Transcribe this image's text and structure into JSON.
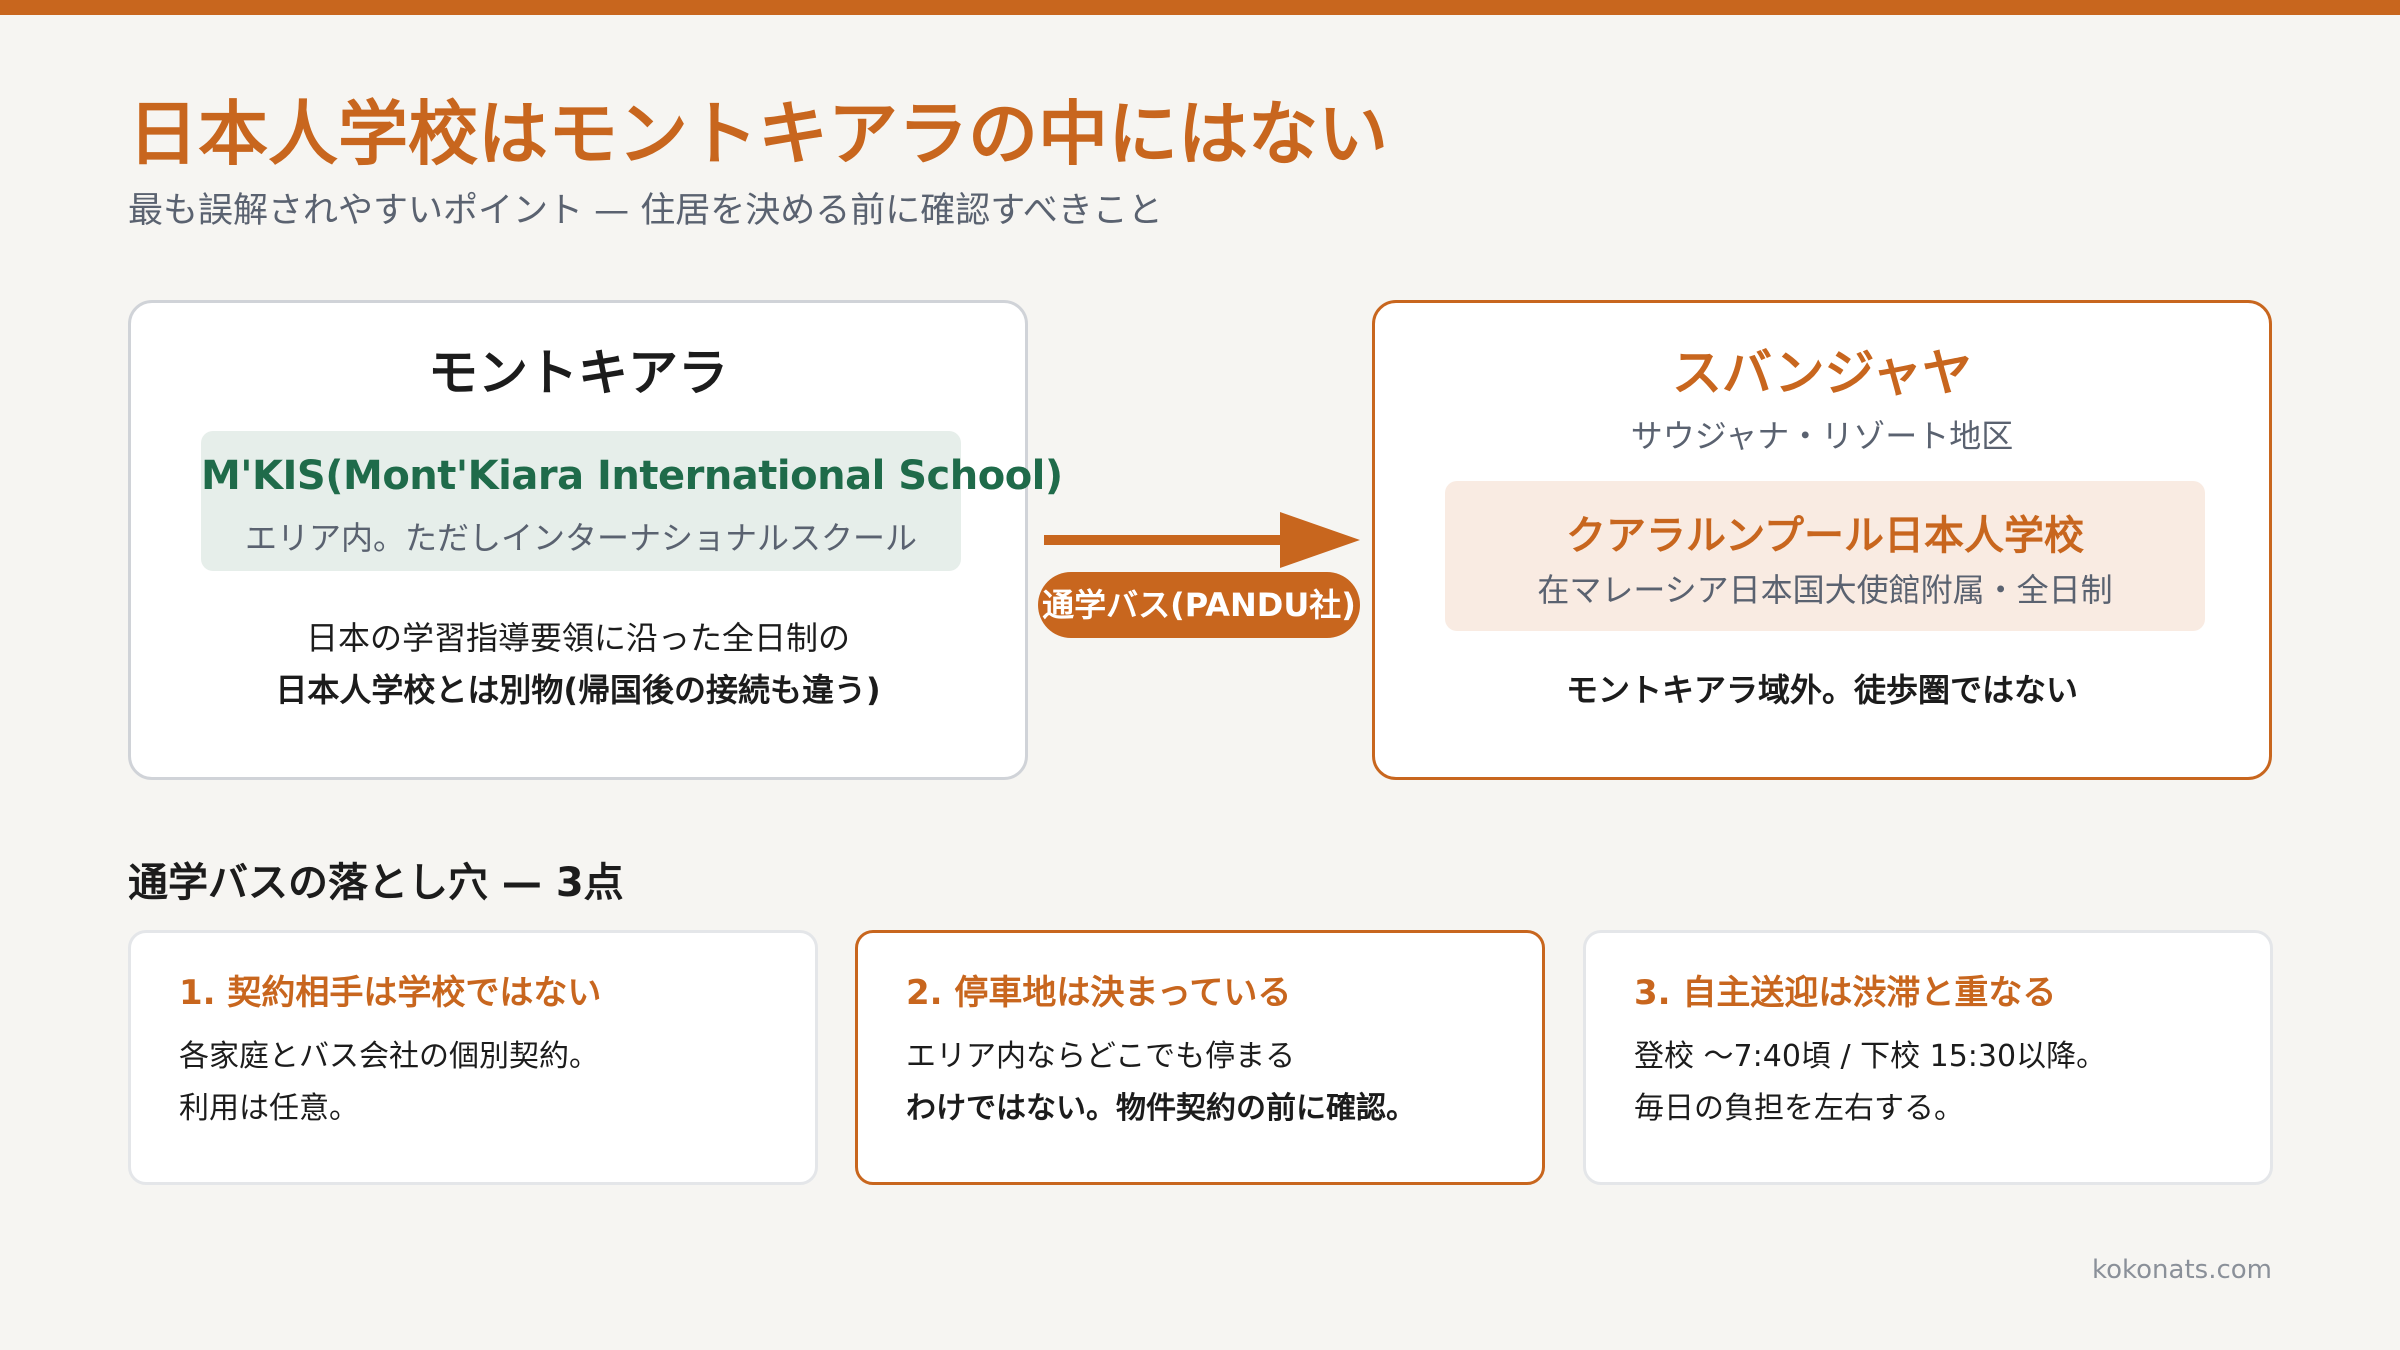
{
  "colors": {
    "accent": "#c8661e",
    "green": "#1f6b4a",
    "muted": "#5a6270"
  },
  "header": {
    "title": "日本人学校はモントキアラの中にはない",
    "subtitle": "最も誤解されやすいポイント — 住居を決める前に確認すべきこと"
  },
  "left_card": {
    "area": "モントキアラ",
    "school_name": "M'KIS(Mont'Kiara International School)",
    "school_desc": "エリア内。ただしインターナショナルスクール",
    "note_line1": "日本の学習指導要領に沿った全日制の",
    "note_line2": "日本人学校とは別物(帰国後の接続も違う)"
  },
  "connector": {
    "label": "通学バス(PANDU社)"
  },
  "right_card": {
    "area": "スバンジャヤ",
    "area_sub": "サウジャナ・リゾート地区",
    "school_name": "クアラルンプール日本人学校",
    "school_desc": "在マレーシア日本国大使館附属・全日制",
    "note_line1": "モントキアラ域外。徒歩圏ではない"
  },
  "pitfalls": {
    "heading": "通学バスの落とし穴 — 3点",
    "items": [
      {
        "title": "1. 契約相手は学校ではない",
        "line1": "各家庭とバス会社の個別契約。",
        "line2": "利用は任意。"
      },
      {
        "title": "2. 停車地は決まっている",
        "line1": "エリア内ならどこでも停まる",
        "line2": "わけではない。物件契約の前に確認。"
      },
      {
        "title": "3. 自主送迎は渋滞と重なる",
        "line1": "登校 〜7:40頃 / 下校 15:30以降。",
        "line2": "毎日の負担を左右する。"
      }
    ]
  },
  "footer": {
    "site": "kokonats.com"
  }
}
